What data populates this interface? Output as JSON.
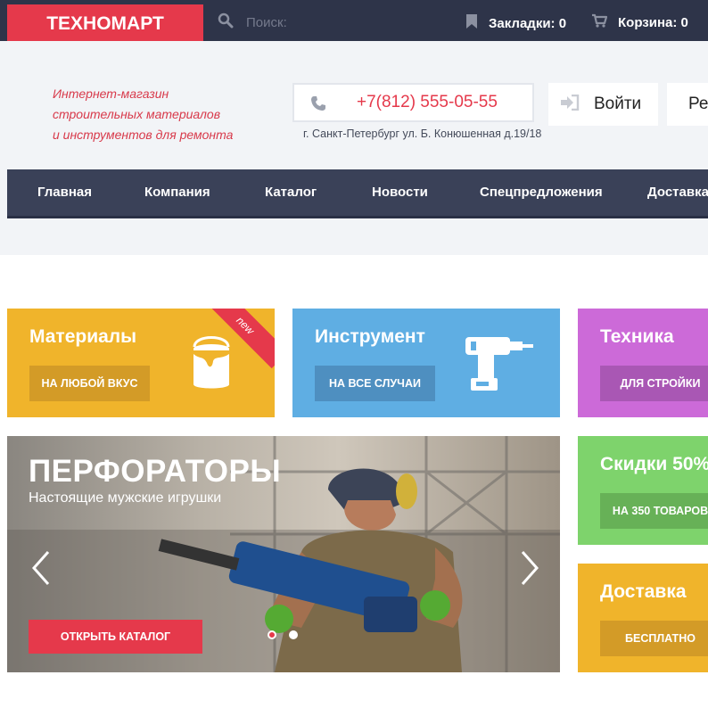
{
  "brand": {
    "logo": "ТЕХНОМАРТ",
    "accent": "#e5394b",
    "dark": "#2e3449"
  },
  "topbar": {
    "search_placeholder": "Поиск:",
    "bookmarks": "Закладки: 0",
    "cart": "Корзина: 0"
  },
  "header": {
    "tagline": [
      "Интернет-магазин",
      "строительных материалов",
      "и инструментов для ремонта"
    ],
    "phone": "+7(812) 555-05-55",
    "address": "г. Санкт-Петербург ул. Б. Конюшенная д.19/18",
    "login": "Войти",
    "register": "Ре"
  },
  "nav": {
    "items": [
      {
        "label": "Главная"
      },
      {
        "label": "Компания"
      },
      {
        "label": "Каталог"
      },
      {
        "label": "Новости"
      },
      {
        "label": "Спецпредложения"
      },
      {
        "label": "Доставка"
      }
    ]
  },
  "tiles": {
    "materials": {
      "title": "Материалы",
      "button": "НА ЛЮБОЙ ВКУС",
      "badge": "new",
      "color": "#f0b42b",
      "btn_color": "#d39b27"
    },
    "tools": {
      "title": "Инструмент",
      "button": "НА ВСЕ СЛУЧАИ",
      "color": "#5faee3",
      "btn_color": "#4e8fc0"
    },
    "tech": {
      "title": "Техника",
      "button": "ДЛЯ СТРОЙКИ",
      "color": "#cc6ad8",
      "btn_color": "#a957b4"
    },
    "discounts": {
      "title": "Скидки 50%",
      "button": "НА 350 ТОВАРОВ",
      "color": "#7ed36c",
      "btn_color": "#67b157"
    },
    "delivery": {
      "title": "Доставка",
      "button": "БЕСПЛАТНО",
      "color": "#f0b42b",
      "btn_color": "#d39b27"
    }
  },
  "hero": {
    "title": "ПЕРФОРАТОРЫ",
    "subtitle": "Настоящие мужские игрушки",
    "button": "ОТКРЫТЬ КАТАЛОГ",
    "slides": 2,
    "active_slide": 1
  }
}
